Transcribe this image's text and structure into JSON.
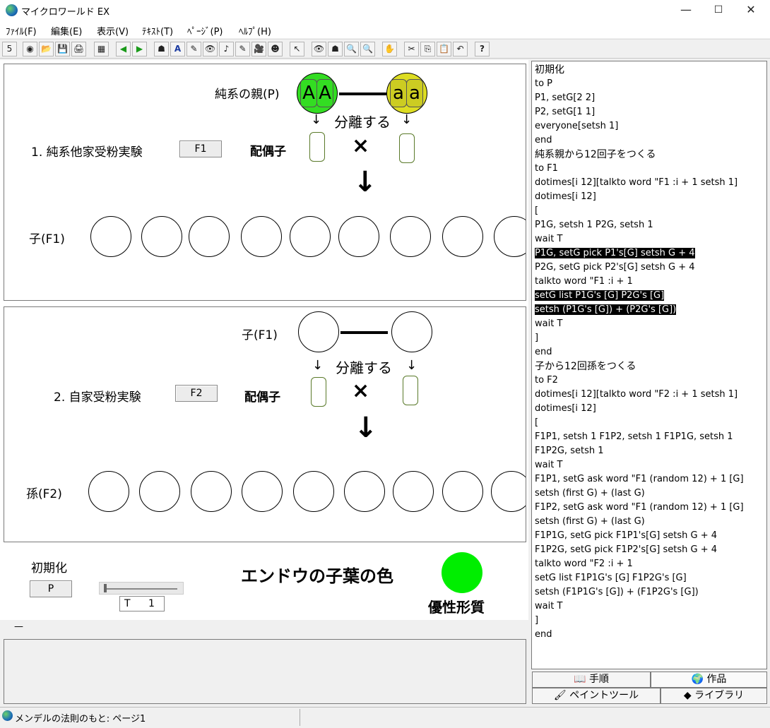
{
  "window": {
    "title": "マイクロワールド EX",
    "minimize": "—",
    "maximize": "☐",
    "close": "✕"
  },
  "menu": [
    "ﾌｧｲﾙ(F)",
    "編集(E)",
    "表示(V)",
    "ﾃｷｽﾄ(T)",
    "ﾍﾟｰｼﾞ(P)",
    "ﾍﾙﾌﾟ(H)"
  ],
  "toolbar": [
    "5",
    "◉",
    "📂",
    "💾",
    "🖨",
    "▦",
    "◀",
    "▶",
    "☗",
    "A",
    "✎",
    "👁",
    "♪",
    "✎",
    "🎥",
    "☻",
    "↖",
    "👁",
    "☗",
    "🔍",
    "🔍",
    "✋",
    "✂",
    "⎘",
    "📋",
    "↶",
    "?"
  ],
  "section1": {
    "parent_label": "純系の親(P)",
    "parent1_alleles": [
      "A",
      "A"
    ],
    "parent2_alleles": [
      "a",
      "a"
    ],
    "arrow_left": "↓",
    "separate": "分離する",
    "arrow_right": "↓",
    "experiment": "1. 純系他家受粉実験",
    "button": "F1",
    "gamete": "配偶子",
    "cross": "×",
    "down_arrow": "↓",
    "offspring_label": "子(F1)",
    "parent1_color": "#33dd22",
    "parent2_color": "#dddd22"
  },
  "section2": {
    "parent_label": "子(F1)",
    "arrow_left": "↓",
    "separate": "分離する",
    "arrow_right": "↓",
    "experiment": "2. 自家受粉実験",
    "button": "F2",
    "gamete": "配偶子",
    "cross": "×",
    "down_arrow": "↓",
    "offspring_label": "孫(F2)"
  },
  "bottom": {
    "init_label": "初期化",
    "init_button": "P",
    "t_label": "T",
    "t_value": "1",
    "slider_value": 0,
    "trait_title": "エンドウの子葉の色",
    "trait_label": "優性形質",
    "trait_color": "#00ee00"
  },
  "command_line": "—",
  "code": [
    {
      "text": "初期化",
      "big": true
    },
    {
      "text": "to P"
    },
    {
      "text": "P1, setG[2 2]"
    },
    {
      "text": "P2, setG[1 1]"
    },
    {
      "text": "everyone[setsh 1]"
    },
    {
      "text": "end"
    },
    {
      "text": "純系親から12回子をつくる",
      "big": true
    },
    {
      "text": "to F1"
    },
    {
      "text": "dotimes[i 12][talkto word \"F1 :i + 1 setsh 1]"
    },
    {
      "text": "dotimes[i 12]"
    },
    {
      "text": "["
    },
    {
      "text": "P1G, setsh 1 P2G, setsh 1"
    },
    {
      "text": "wait T"
    },
    {
      "text": "P1G, setG pick P1's[G]  setsh G + 4",
      "hl": true
    },
    {
      "text": "P2G,  setG pick P2's[G] setsh G + 4"
    },
    {
      "text": "talkto word \"F1 :i + 1"
    },
    {
      "text": "setG list P1G's [G]  P2G's [G]",
      "hl": true
    },
    {
      "text": "setsh (P1G's [G]) + (P2G's [G])",
      "hl": true
    },
    {
      "text": "wait T"
    },
    {
      "text": "]"
    },
    {
      "text": "end"
    },
    {
      "text": "子から12回孫をつくる",
      "big": true
    },
    {
      "text": "to F2"
    },
    {
      "text": "dotimes[i 12][talkto word \"F2 :i + 1 setsh 1]"
    },
    {
      "text": "dotimes[i 12]"
    },
    {
      "text": "["
    },
    {
      "text": "F1P1, setsh 1 F1P2, setsh 1 F1P1G, setsh 1"
    },
    {
      "text": "F1P2G, setsh 1"
    },
    {
      "text": "wait T"
    },
    {
      "text": "F1P1, setG ask word \"F1 (random 12) + 1 [G]"
    },
    {
      "text": " setsh (first G) + (last G)"
    },
    {
      "text": "F1P2, setG ask word \"F1 (random 12) + 1 [G]"
    },
    {
      "text": " setsh (first G) + (last G)"
    },
    {
      "text": "F1P1G, setG pick F1P1's[G]  setsh G + 4"
    },
    {
      "text": "F1P2G,  setG pick F1P2's[G] setsh G + 4"
    },
    {
      "text": "talkto word \"F2 :i + 1"
    },
    {
      "text": "setG list F1P1G's [G]  F1P2G's [G]"
    },
    {
      "text": "setsh (F1P1G's [G]) + (F1P2G's [G])"
    },
    {
      "text": "wait T"
    },
    {
      "text": "]"
    },
    {
      "text": "end"
    }
  ],
  "tabs": {
    "procedures": "手順",
    "projects": "作品",
    "paint": "ペイントツール",
    "library": "ライブラリ"
  },
  "status": {
    "text": "メンデルの法則のもと: ページ1"
  }
}
